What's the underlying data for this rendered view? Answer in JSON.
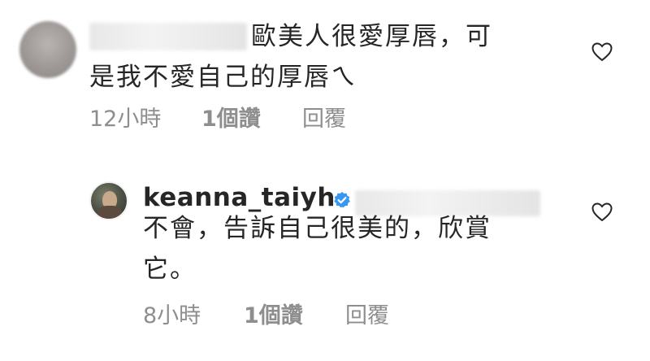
{
  "comments": [
    {
      "text_line1": "歐美人很愛厚唇，可",
      "text_line2": "是我不愛自己的厚唇ㄟ",
      "time": "12小時",
      "likes": "1個讚",
      "reply": "回覆"
    },
    {
      "username": "keanna_taiyh",
      "text_line1": "不會，告訴自己很美的，欣賞",
      "text_line2": "它。",
      "time": "8小時",
      "likes": "1個讚",
      "reply": "回覆"
    }
  ],
  "icons": {
    "like": "heart-outline-icon",
    "verified": "verified-badge-icon"
  },
  "colors": {
    "text": "#262626",
    "meta": "#8e8e8e",
    "verified": "#3897f0"
  }
}
